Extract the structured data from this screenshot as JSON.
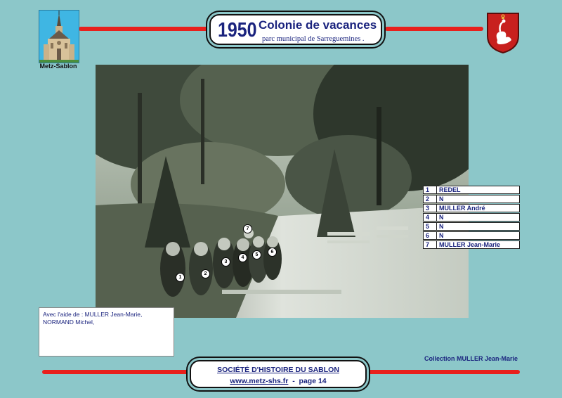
{
  "header": {
    "year": "1950",
    "title": "Colonie de vacances",
    "subtitle": "parc municipal de Sarreguemines ."
  },
  "logo_left": {
    "caption": "Metz-Sablon",
    "icon": "church-icon"
  },
  "logo_right": {
    "icon": "coat-of-arms-icon"
  },
  "colors": {
    "background": "#8cc7c9",
    "accent_red": "#e8201c",
    "text_navy": "#1a237e"
  },
  "photo": {
    "markers": [
      "1",
      "2",
      "3",
      "4",
      "5",
      "6",
      "7"
    ]
  },
  "legend": [
    {
      "num": "1",
      "name": "REDEL"
    },
    {
      "num": "2",
      "name": "N"
    },
    {
      "num": "3",
      "name": "MULLER André"
    },
    {
      "num": "4",
      "name": "N"
    },
    {
      "num": "5",
      "name": "N"
    },
    {
      "num": "6",
      "name": "N"
    },
    {
      "num": "7",
      "name": "MULLER Jean-Marie"
    }
  ],
  "note": {
    "text": "Avec l'aide de : MULLER Jean-Marie, NORMAND Michel,"
  },
  "collection": "Collection MULLER Jean-Marie",
  "footer": {
    "society": "SOCIÉTÉ D'HISTOIRE DU SABLON",
    "url": "www.metz-shs.fr",
    "separator": "  -  ",
    "page": "page 14"
  }
}
